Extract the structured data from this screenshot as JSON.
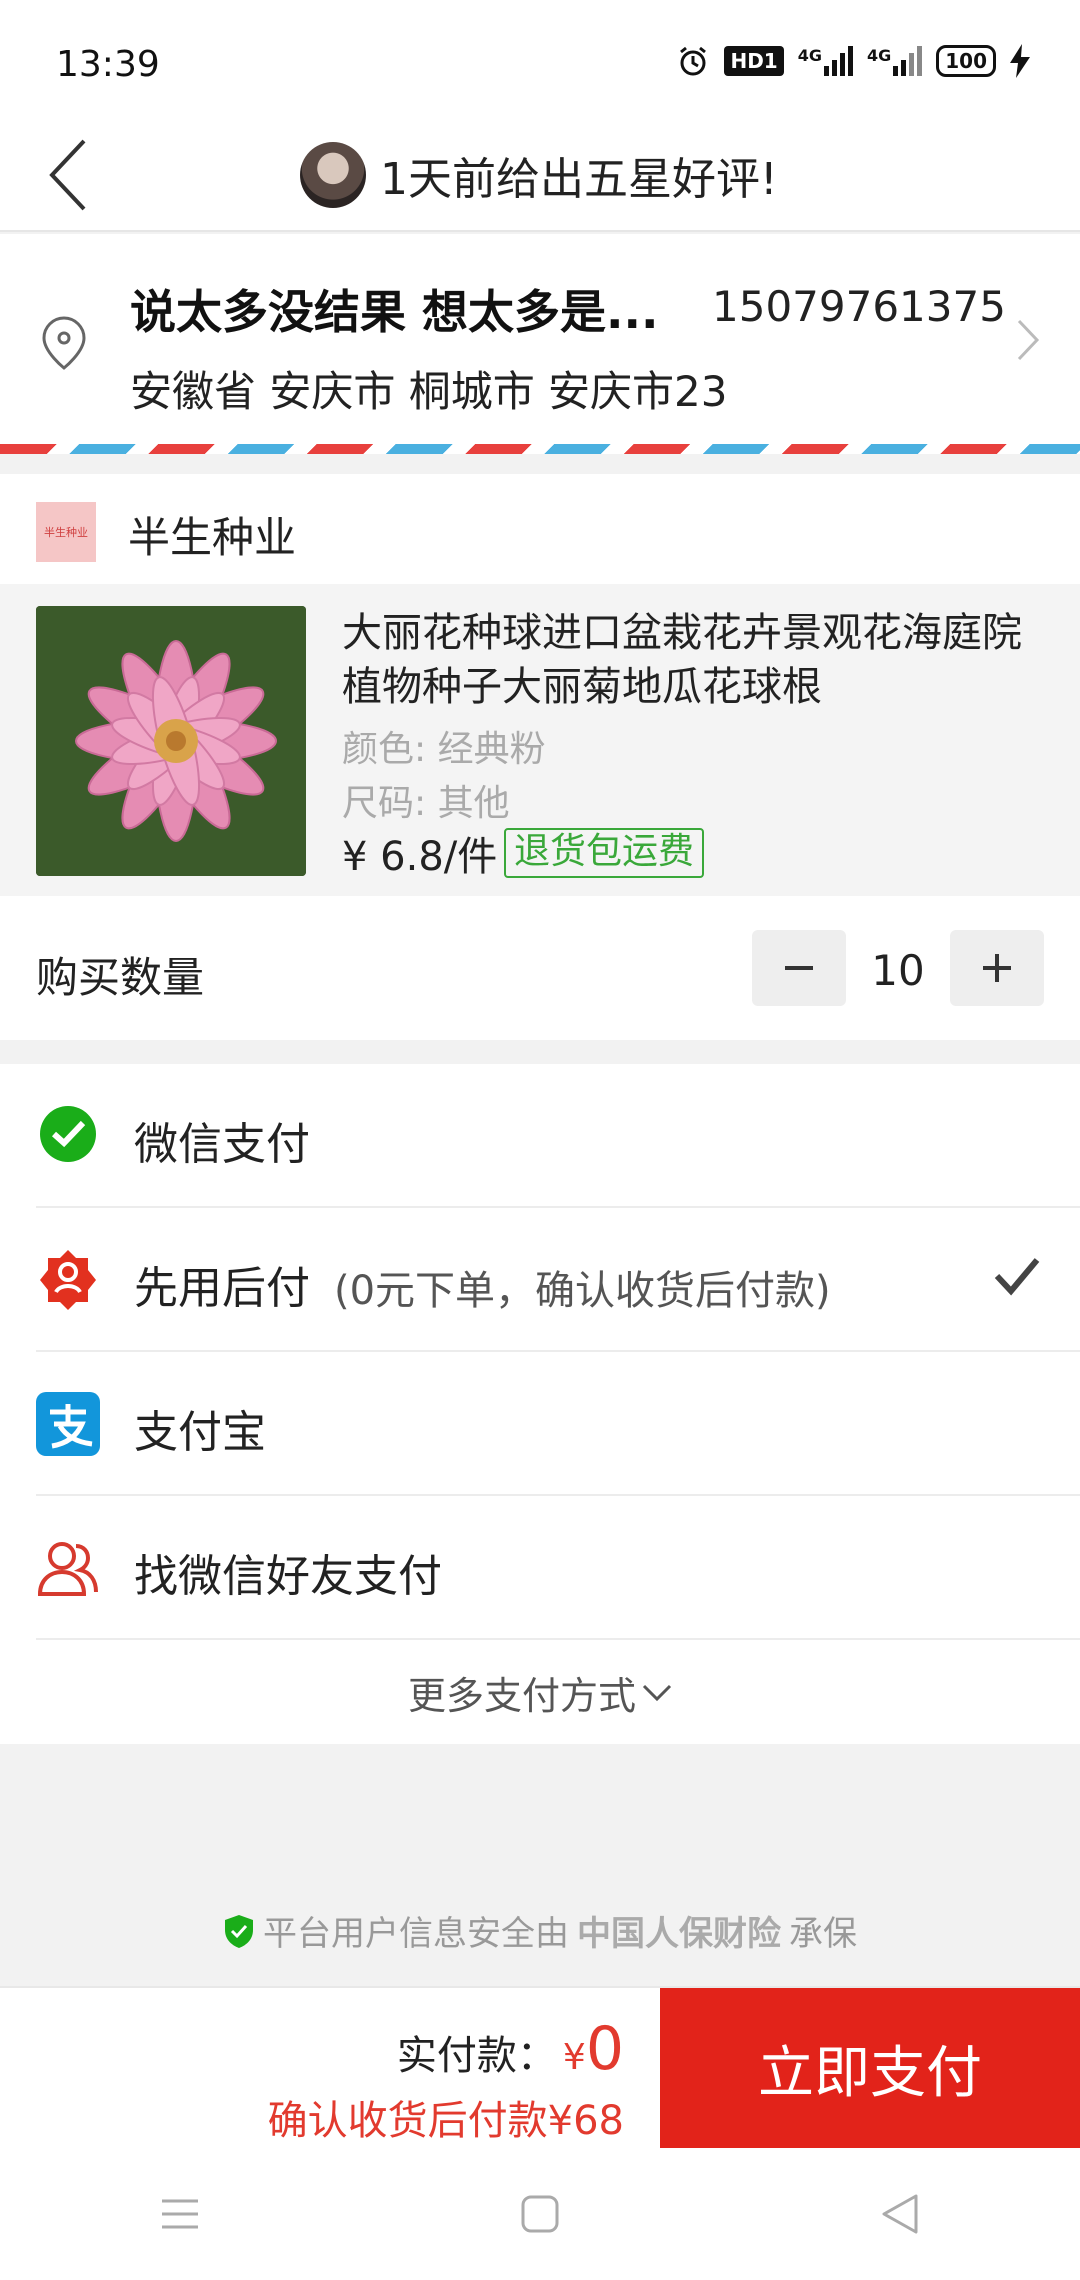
{
  "status_bar": {
    "time": "13:39",
    "network_1": "4G",
    "network_2": "4G",
    "hd_label": "HD1",
    "battery": "100"
  },
  "header": {
    "review_text": "1天前给出五星好评!"
  },
  "address": {
    "name": "说太多没结果 想太多是...",
    "phone": "15079761375",
    "line": "安徽省 安庆市 桐城市 安庆市23"
  },
  "shop": {
    "logo_text": "半生种业",
    "name": "半生种业"
  },
  "product": {
    "title": "大丽花种球进口盆栽花卉景观花海庭院植物种子大丽菊地瓜花球根",
    "color": "颜色: 经典粉",
    "size": "尺码: 其他",
    "price": "¥ 6.8/件",
    "return_badge": "退货包运费"
  },
  "quantity": {
    "label": "购买数量",
    "value": "10"
  },
  "payments": {
    "wechat": "微信支付",
    "later": "先用后付",
    "later_note": "(0元下单，确认收货后付款)",
    "alipay": "支付宝",
    "friend": "找微信好友支付",
    "more": "更多支付方式"
  },
  "insurance": {
    "prefix": "平台用户信息安全由",
    "company": "中国人保财险",
    "suffix": "承保"
  },
  "checkout": {
    "paid_label": "实付款：",
    "currency": "¥",
    "paid_amount": "0",
    "after_text": "确认收货后付款¥68",
    "pay_button": "立即支付"
  },
  "colors": {
    "accent_red": "#e2231a",
    "wechat_green": "#1aad19",
    "alipay_blue": "#1296db",
    "badge_green": "#3aa83a"
  }
}
